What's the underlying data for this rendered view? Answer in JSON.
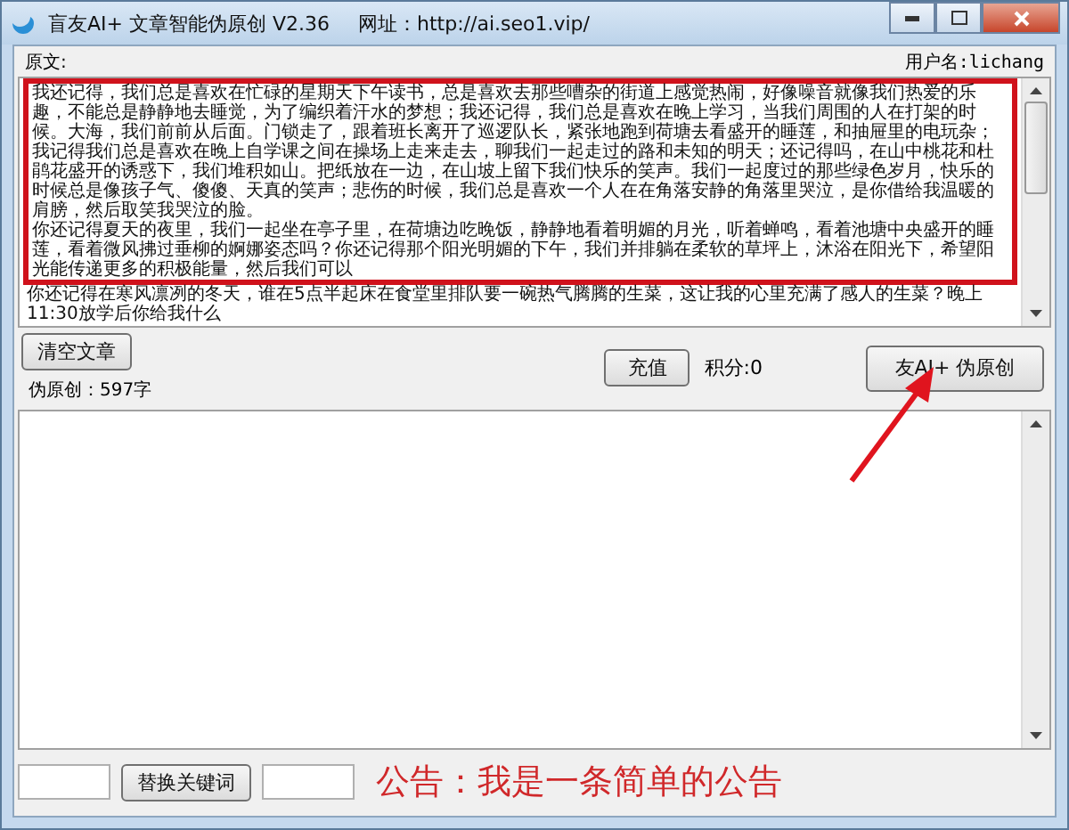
{
  "window": {
    "title": "盲友AI+ 文章智能伪原创 V2.36",
    "url_label": "网址：http://ai.seo1.vip/"
  },
  "source": {
    "label": "原文:",
    "user": "用户名:lichang",
    "paragraphs": [
      {
        "text": "我还记得，我们总是喜欢在忙碌的星期天下午读书，总是喜欢去那些嘈杂的街道上感觉热闹，好像噪音就像我们热爱的乐趣，不能总是静静地去睡觉，为了编织着汗水的梦想；我还记得，我们总是喜欢在晚上学习，当我们周围的人在打架的时候。大海，我们前前从后面。门锁走了，跟着班长离开了巡逻队长，紧张地跑到荷塘去看盛开的睡莲，和抽屉里的电玩杂；我记得我们总是喜欢在晚上自学课之间在操场上走来走去，聊我们一起走过的路和未知的明天；还记得吗，在山中桃花和杜鹃花盛开的诱惑下，我们堆积如山。把纸放在一边，在山坡上留下我们快乐的笑声。我们一起度过的那些绿色岁月，快乐的时候总是像孩子气、傻傻、天真的笑声；悲伤的时候，我们总是喜欢一个人在在角落安静的角落里哭泣，是你借给我温暖的肩膀，然后取笑我哭泣的脸。",
        "highlighted": true
      },
      {
        "text": "你还记得夏天的夜里，我们一起坐在亭子里，在荷塘边吃晚饭，静静地看着明媚的月光，听着蝉鸣，看着池塘中央盛开的睡莲，看着微风拂过垂柳的婀娜姿态吗？你还记得那个阳光明媚的下午，我们并排躺在柔软的草坪上，沐浴在阳光下，希望阳光能传递更多的积极能量，然后我们可以",
        "highlighted": true
      },
      {
        "text": "你还记得在寒风凛冽的冬天，谁在5点半起床在食堂里排队要一碗热气腾腾的生菜，这让我的心里充满了感人的生菜？晚上11:30放学后你给我什么",
        "highlighted": false
      }
    ]
  },
  "controls": {
    "clear_button": "清空文章",
    "count": "伪原创：597字",
    "recharge_button": "充值",
    "points": "积分:0",
    "rewrite_button": "友AI+ 伪原创"
  },
  "bottom": {
    "replace_button": "替换关键词",
    "notice": "公告：我是一条简单的公告"
  }
}
